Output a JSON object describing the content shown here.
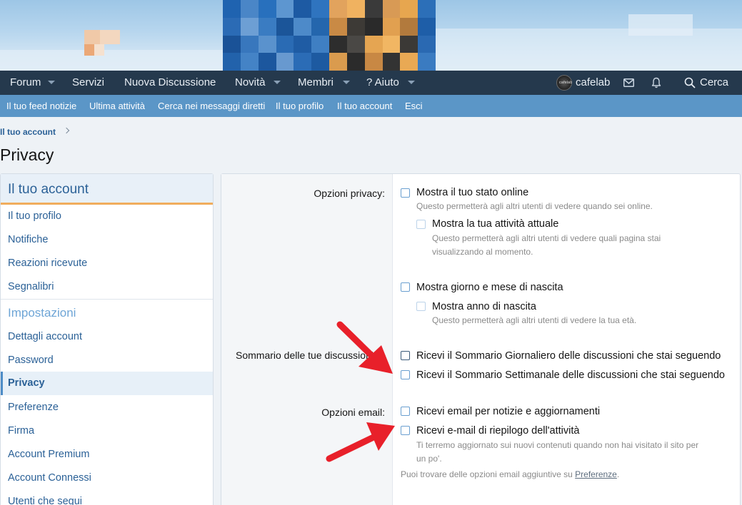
{
  "nav": {
    "items": [
      {
        "label": "Forum",
        "has_menu": true
      },
      {
        "label": "Servizi",
        "has_menu": false
      },
      {
        "label": "Nuova Discussione",
        "has_menu": false
      },
      {
        "label": "Novità",
        "has_menu": true
      },
      {
        "label": "Membri",
        "has_menu": true
      },
      {
        "label": "? Aiuto",
        "has_menu": true
      }
    ],
    "username": "cafelab",
    "avatar_text": "cafelab",
    "mail_icon": "envelope-icon",
    "alerts_icon": "bell-icon",
    "search_label": "Cerca"
  },
  "subnav": {
    "items": [
      "Il tuo feed notizie",
      "Ultima attività",
      "Cerca nei messaggi diretti",
      "Il tuo profilo",
      "Il tuo account",
      "Esci"
    ]
  },
  "breadcrumb": {
    "label": "Il tuo account"
  },
  "page": {
    "title": "Privacy"
  },
  "sidebar": {
    "header": "Il tuo account",
    "items": [
      "Il tuo profilo",
      "Notifiche",
      "Reazioni ricevute",
      "Segnalibri"
    ],
    "group_label": "Impostazioni",
    "settings_items": [
      "Dettagli account",
      "Password",
      "Privacy",
      "Preferenze",
      "Firma",
      "Account Premium",
      "Account Connessi",
      "Utenti che segui"
    ],
    "active_item": "Privacy"
  },
  "privacy": {
    "label": "Opzioni privacy:",
    "show_online": {
      "label": "Mostra il tuo stato online",
      "hint": "Questo permetterà agli altri utenti di vedere quando sei online."
    },
    "show_activity": {
      "label": "Mostra la tua attività attuale",
      "hint_line1": "Questo permetterà agli altri utenti di vedere quali pagina stai",
      "hint_line2": "visualizzando al momento."
    },
    "show_birthday": {
      "label": "Mostra giorno e mese di nascita"
    },
    "show_birth_year": {
      "label": "Mostra anno di nascita",
      "hint": "Questo permetterà agli altri utenti di vedere la tua età."
    }
  },
  "digest": {
    "label": "Sommario delle tue discussioni:",
    "daily": {
      "label": "Ricevi il Sommario Giornaliero delle discussioni che stai seguendo"
    },
    "weekly": {
      "label": "Ricevi il Sommario Settimanale delle discussioni che stai seguendo"
    }
  },
  "email": {
    "label": "Opzioni email:",
    "news": {
      "label": "Ricevi email per notizie e aggiornamenti"
    },
    "activity": {
      "label": "Ricevi e-mail di riepilogo dell'attività",
      "hint_line1": "Ti terremo aggiornato sui nuovi contenuti quando non hai visitato il sito per",
      "hint_line2": "un po'."
    },
    "more_prefix": "Puoi trovare delle opzioni email aggiuntive su",
    "more_link": "Preferenze",
    "more_suffix": "."
  },
  "colors": {
    "nav_bg": "#25394d",
    "subnav_bg": "#5b96c7",
    "link": "#2b6197",
    "accent_underline": "#f0ad5d",
    "annotation_arrow": "#e8202a"
  }
}
